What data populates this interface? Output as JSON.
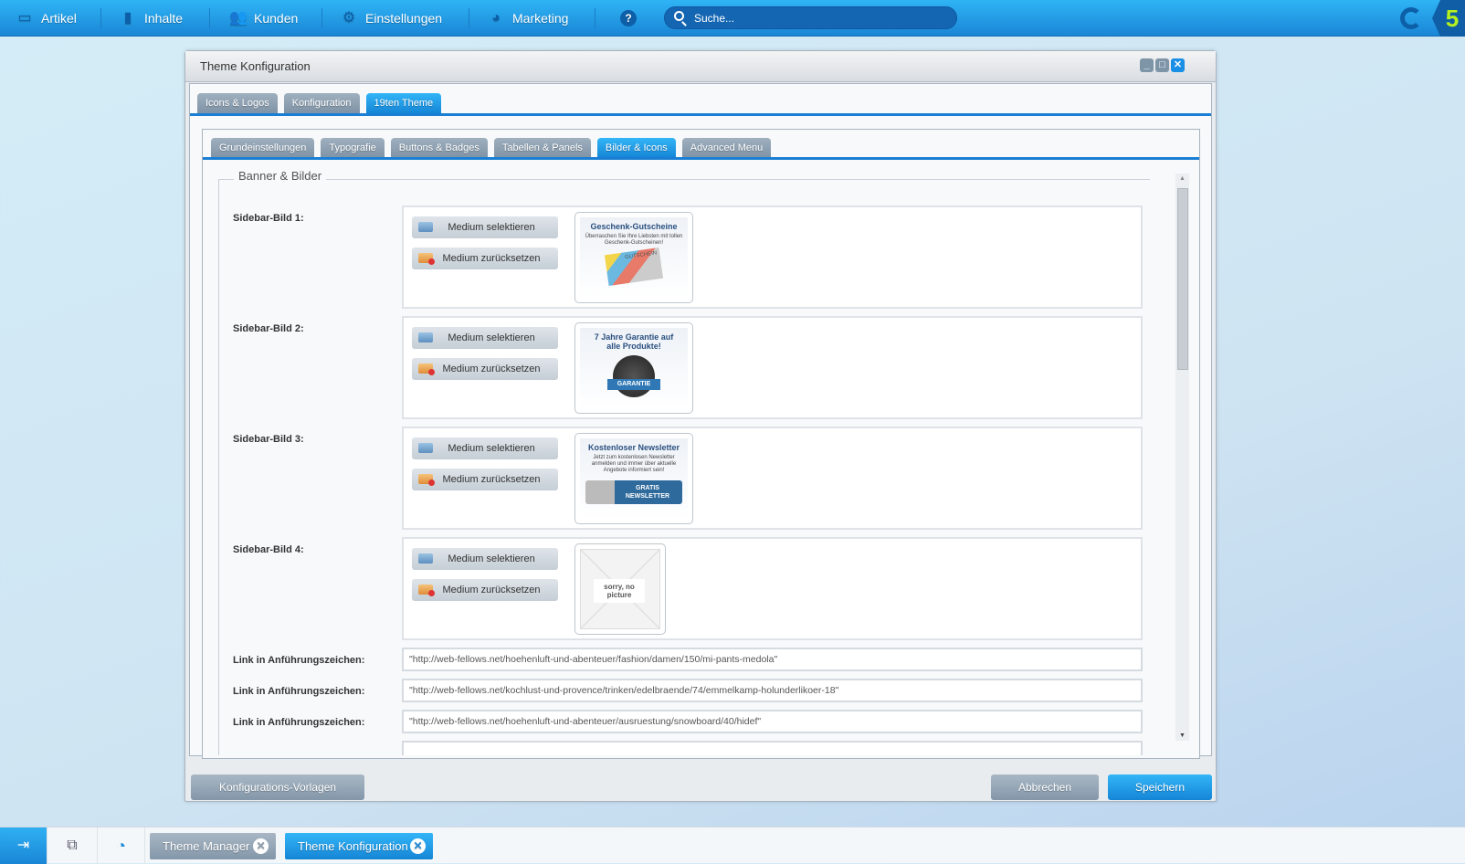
{
  "topnav": {
    "items": [
      {
        "label": "Artikel",
        "icon": "inbox-icon"
      },
      {
        "label": "Inhalte",
        "icon": "document-icon"
      },
      {
        "label": "Kunden",
        "icon": "users-icon"
      },
      {
        "label": "Einstellungen",
        "icon": "gear-icon"
      },
      {
        "label": "Marketing",
        "icon": "pie-chart-icon"
      }
    ],
    "help": "?",
    "search_placeholder": "Suche...",
    "brand_badge": "5"
  },
  "window": {
    "title": "Theme Konfiguration",
    "outer_tabs": [
      {
        "label": "Icons & Logos"
      },
      {
        "label": "Konfiguration"
      },
      {
        "label": "19ten Theme",
        "active": true
      }
    ],
    "inner_tabs": [
      {
        "label": "Grundeinstellungen"
      },
      {
        "label": "Typografie"
      },
      {
        "label": "Buttons & Badges"
      },
      {
        "label": "Tabellen & Panels"
      },
      {
        "label": "Bilder & Icons",
        "active": true
      },
      {
        "label": "Advanced Menu"
      }
    ],
    "fieldset_legend": "Banner & Bilder",
    "select_label": "Medium selektieren",
    "reset_label": "Medium zurücksetzen",
    "images": [
      {
        "label": "Sidebar-Bild 1:",
        "title": "Geschenk-Gutscheine",
        "text": "Überraschen Sie Ihre Liebsten mit tollen Geschenk-Gutscheinen!",
        "badge": "GUTSCHEIN"
      },
      {
        "label": "Sidebar-Bild 2:",
        "title": "7 Jahre Garantie auf alle Produkte!",
        "text": "",
        "badge": "GARANTIE"
      },
      {
        "label": "Sidebar-Bild 3:",
        "title": "Kostenloser Newsletter",
        "text": "Jetzt zum kostenlosen Newsletter anmelden und immer über aktuelle Angebote informiert sein!",
        "badge": "GRATIS NEWSLETTER"
      },
      {
        "label": "Sidebar-Bild 4:",
        "title": "",
        "text": "sorry, no picture",
        "badge": ""
      }
    ],
    "links": [
      {
        "label": "Link in Anführungszeichen:",
        "value": "\"http://web-fellows.net/hoehenluft-und-abenteuer/fashion/damen/150/mi-pants-medola\""
      },
      {
        "label": "Link in Anführungszeichen:",
        "value": "\"http://web-fellows.net/kochlust-und-provence/trinken/edelbraende/74/emmelkamp-holunderlikoer-18\""
      },
      {
        "label": "Link in Anführungszeichen:",
        "value": "\"http://web-fellows.net/hoehenluft-und-abenteuer/ausruestung/snowboard/40/hidef\""
      }
    ],
    "buttons": {
      "templates": "Konfigurations-Vorlagen",
      "cancel": "Abbrechen",
      "save": "Speichern"
    }
  },
  "taskbar": {
    "tabs": [
      {
        "label": "Theme Manager"
      },
      {
        "label": "Theme Konfiguration",
        "active": true
      }
    ]
  },
  "colors": {
    "accent": "#1a86d6",
    "active_tab": "#1585d6",
    "inactive_tab": "#8a9db0",
    "brand_green": "#b6f01e"
  }
}
